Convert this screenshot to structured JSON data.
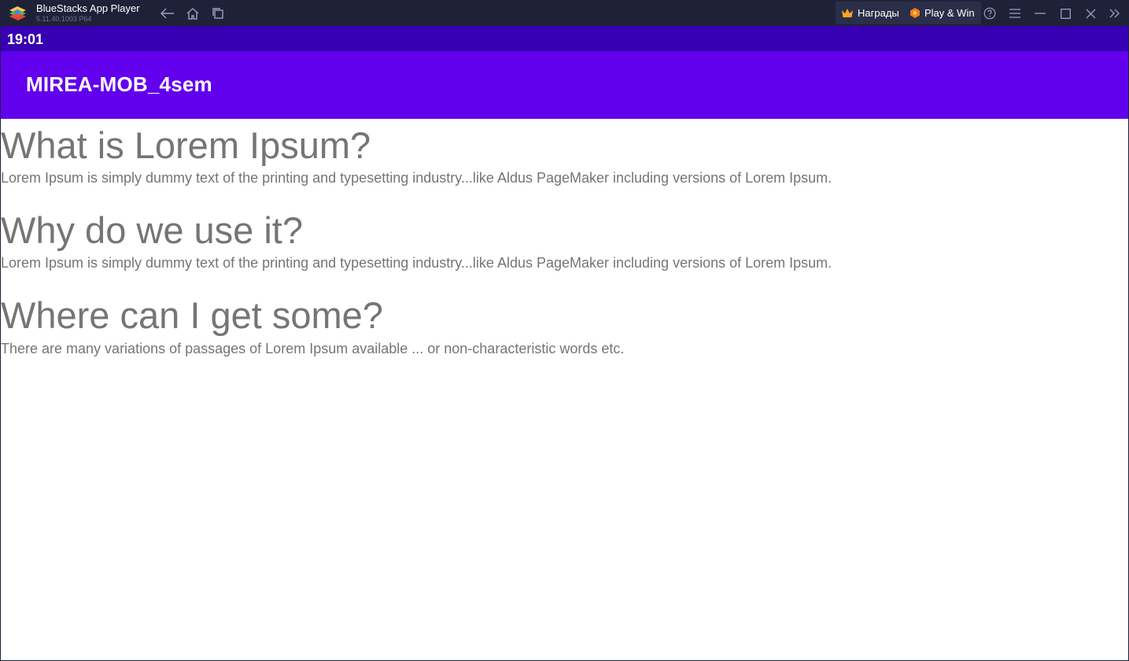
{
  "window": {
    "title": "BlueStacks App Player",
    "version": "5.11.40.1003  P64",
    "rewards_label": "Награды",
    "playwin_label": "Play & Win",
    "icons": [
      "back-icon",
      "home-icon",
      "multitask-icon",
      "crown-icon",
      "playwin-icon",
      "help-icon",
      "menu-icon",
      "minimize-icon",
      "maximize-icon",
      "close-icon",
      "collapse-sidebar-icon"
    ]
  },
  "statusbar": {
    "time": "19:01"
  },
  "appbar": {
    "title": "MIREA-MOB_4sem"
  },
  "sections": [
    {
      "heading": "What is Lorem Ipsum?",
      "body": "Lorem Ipsum is simply dummy text of the printing and typesetting industry...like Aldus PageMaker including versions of Lorem Ipsum."
    },
    {
      "heading": "Why do we use it?",
      "body": "Lorem Ipsum is simply dummy text of the printing and typesetting industry...like Aldus PageMaker including versions of Lorem Ipsum."
    },
    {
      "heading": "Where can I get some?",
      "body": "There are many variations of passages of Lorem Ipsum available ... or non-characteristic words etc."
    }
  ],
  "colors": {
    "titlebar": "#1f2138",
    "statusbar": "#3700b3",
    "appbar": "#6200ee",
    "text": "#757575"
  }
}
